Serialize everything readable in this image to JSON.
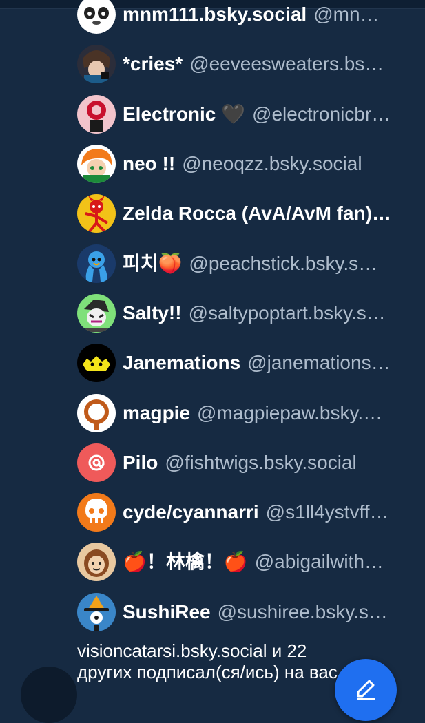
{
  "users": [
    {
      "name": "mnm111.bsky.social",
      "handle": "@mn…",
      "avatar": "panda-face-icon"
    },
    {
      "name": "*cries*",
      "handle": "@eeveesweaters.bs…",
      "avatar": "dark-haired-character-icon"
    },
    {
      "name": "Electronic 🖤",
      "handle": "@electronicbr…",
      "avatar": "red-mask-icon"
    },
    {
      "name": "neo !!",
      "handle": "@neoqzz.bsky.social",
      "avatar": "orange-character-icon"
    },
    {
      "name": "Zelda Rocca (AvA/AvM fan)…",
      "handle": "",
      "avatar": "red-stickfigure-icon"
    },
    {
      "name": "피치🍑",
      "handle": "@peachstick.bsky.s…",
      "avatar": "blue-character-icon"
    },
    {
      "name": "Salty!!",
      "handle": "@saltypoptart.bsky.s…",
      "avatar": "green-character-icon"
    },
    {
      "name": "Janemations",
      "handle": "@janemations…",
      "avatar": "yellow-face-icon"
    },
    {
      "name": "magpie",
      "handle": "@magpiepaw.bsky.…",
      "avatar": "orange-ring-icon"
    },
    {
      "name": "Pilo",
      "handle": "@fishtwigs.bsky.social",
      "avatar": "at-sign-icon"
    },
    {
      "name": "cyde/cyannarri",
      "handle": "@s1ll4ystvff…",
      "avatar": "skull-face-icon"
    },
    {
      "name": "🍎！林檎！🍎",
      "handle": "@abigailwith…",
      "avatar": "brown-character-icon"
    },
    {
      "name": "SushiRee",
      "handle": "@sushiree.bsky.s…",
      "avatar": "witch-hat-icon"
    }
  ],
  "footer": {
    "line1": "visioncatarsi.bsky.social и 22",
    "line2": "других подписал(ся/ись) на вас"
  },
  "colors": {
    "background": "#162a42",
    "name": "#ffffff",
    "handle": "#aebccc",
    "accent": "#1f6ff0",
    "pilo_avatar": "#ef5a5a"
  },
  "fab": {
    "icon": "compose-pencil-icon"
  }
}
